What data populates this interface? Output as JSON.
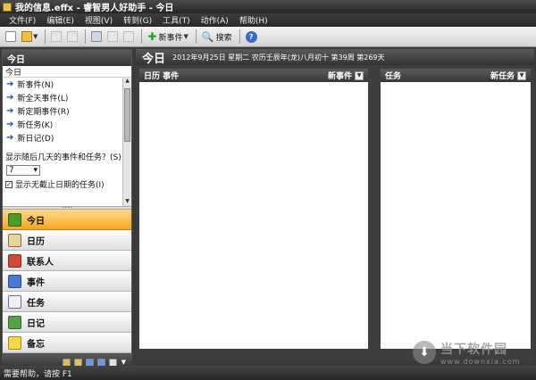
{
  "window": {
    "title": "我的信息.effx - 睿智男人好助手 - 今日"
  },
  "menu": [
    "文件(F)",
    "编辑(E)",
    "视图(V)",
    "转到(G)",
    "工具(T)",
    "动作(A)",
    "帮助(H)"
  ],
  "toolbar": {
    "new_event_label": "新事件",
    "search_label": "搜索",
    "help_glyph": "?"
  },
  "left_pane": {
    "header": "今日",
    "panel_title": "今日",
    "links": [
      "新事件(N)",
      "新全天事件(L)",
      "新定期事件(R)",
      "新任务(K)",
      "新日记(D)"
    ],
    "show_days_label": "显示随后几天的事件和任务？(S)",
    "days_value": "7",
    "show_undated_label": "显示无截止日期的任务(I)",
    "nav": [
      {
        "label": "今日",
        "icon": "home-icon"
      },
      {
        "label": "日历",
        "icon": "calendar-icon"
      },
      {
        "label": "联系人",
        "icon": "contacts-icon"
      },
      {
        "label": "事件",
        "icon": "events-icon"
      },
      {
        "label": "任务",
        "icon": "tasks-icon"
      },
      {
        "label": "日记",
        "icon": "diary-icon"
      },
      {
        "label": "备忘",
        "icon": "notes-icon"
      }
    ],
    "active_nav": "今日"
  },
  "content": {
    "title": "今日",
    "date_line": "2012年9月25日 星期二 农历壬辰年(龙)八月初十 第39周 第269天",
    "events_col": {
      "title": "日历 事件",
      "add_label": "新事件"
    },
    "tasks_col": {
      "title": "任务",
      "add_label": "新任务"
    }
  },
  "status": {
    "text": "需要帮助，请按 F1"
  },
  "watermark": {
    "name": "当下软件园",
    "url": "www.downxia.com"
  }
}
